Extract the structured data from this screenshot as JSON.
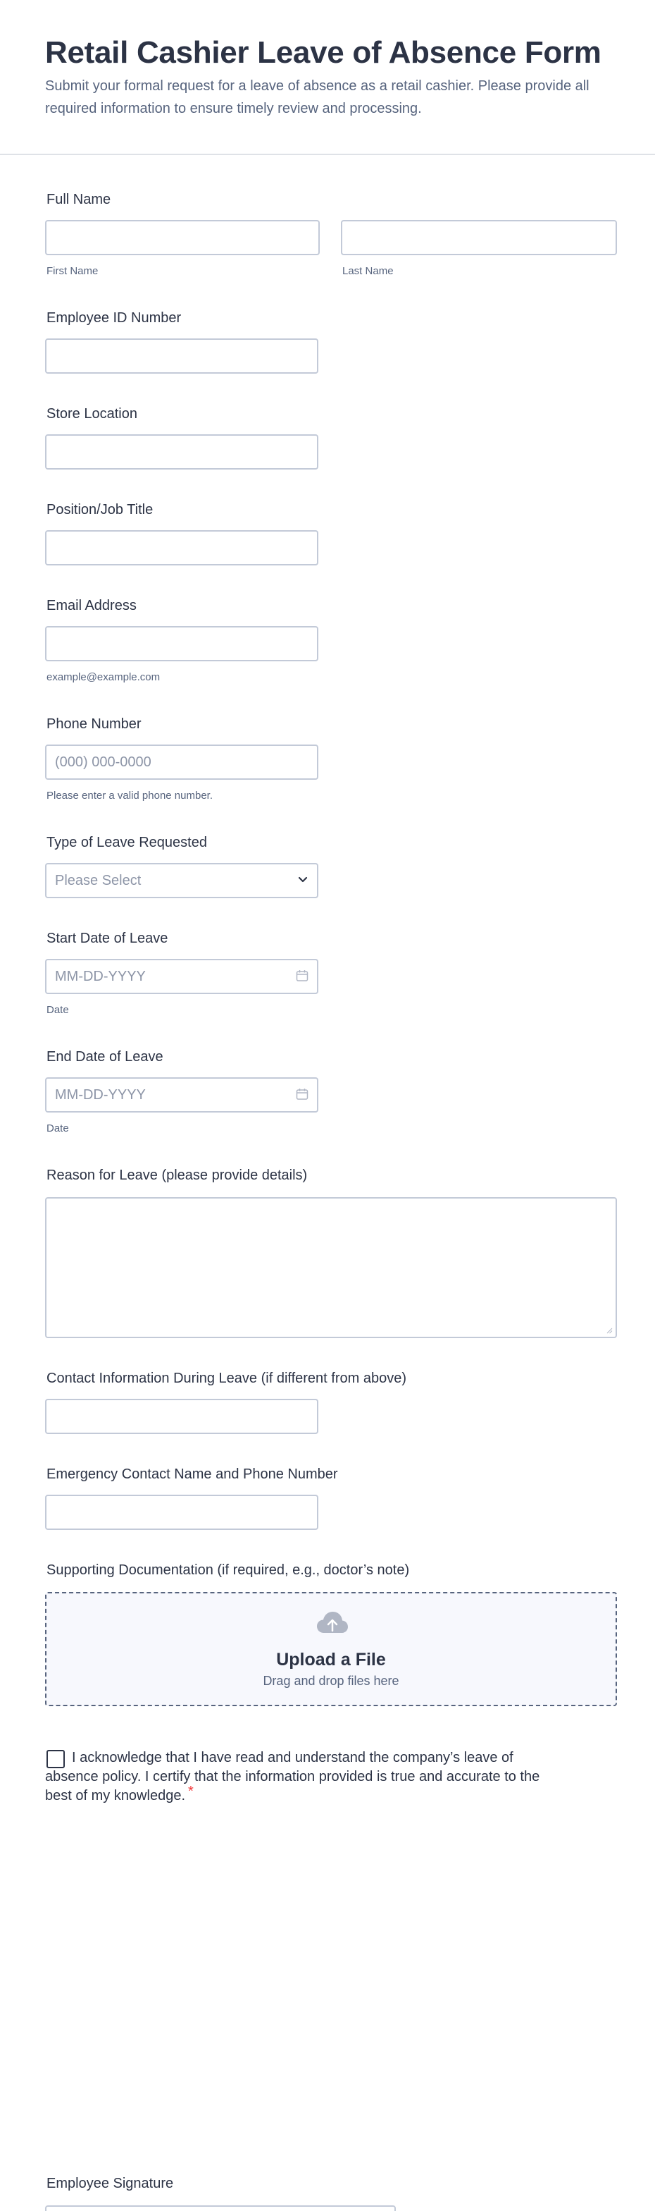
{
  "form": {
    "title": "Retail Cashier Leave of Absence Form",
    "subtitle": "Submit your formal request for a leave of absence as a retail cashier. Please provide all required information to ensure timely review and processing."
  },
  "fields": {
    "full_name": {
      "label": "Full Name",
      "first_sublabel": "First Name",
      "last_sublabel": "Last Name",
      "first_value": "",
      "last_value": ""
    },
    "employee_id": {
      "label": "Employee ID Number",
      "value": ""
    },
    "store_location": {
      "label": "Store Location",
      "value": ""
    },
    "position": {
      "label": "Position/Job Title",
      "value": ""
    },
    "email": {
      "label": "Email Address",
      "sublabel": "example@example.com",
      "value": ""
    },
    "phone": {
      "label": "Phone Number",
      "placeholder": "(000) 000-0000",
      "sublabel": "Please enter a valid phone number.",
      "value": ""
    },
    "leave_type": {
      "label": "Type of Leave Requested",
      "selected": "Please Select"
    },
    "start_date": {
      "label": "Start Date of Leave",
      "placeholder": "MM-DD-YYYY",
      "sublabel": "Date"
    },
    "end_date": {
      "label": "End Date of Leave",
      "placeholder": "MM-DD-YYYY",
      "sublabel": "Date"
    },
    "reason": {
      "label": "Reason for Leave (please provide details)",
      "value": ""
    },
    "contact_during": {
      "label": "Contact Information During Leave (if different from above)",
      "value": ""
    },
    "emergency_contact": {
      "label": "Emergency Contact Name and Phone Number",
      "value": ""
    },
    "documentation": {
      "label": "Supporting Documentation (if required, e.g., doctor’s note)",
      "upload_title": "Upload a File",
      "upload_sub": "Drag and drop files here"
    },
    "acknowledgement": {
      "text": "I acknowledge that I have read and understand the company’s leave of absence policy. I certify that the information provided is true and accurate to the best of my knowledge.",
      "required_mark": "*",
      "checked": false
    },
    "signature": {
      "label": "Employee Signature"
    }
  },
  "icons": {
    "calendar": "calendar-icon",
    "chevron": "chevron-down-icon",
    "upload": "cloud-upload-icon"
  },
  "colors": {
    "text": "#2c3345",
    "muted": "#57647e",
    "border": "#c3cad8",
    "required": "#f23a3c",
    "upload_bg": "#f7f8fd"
  }
}
